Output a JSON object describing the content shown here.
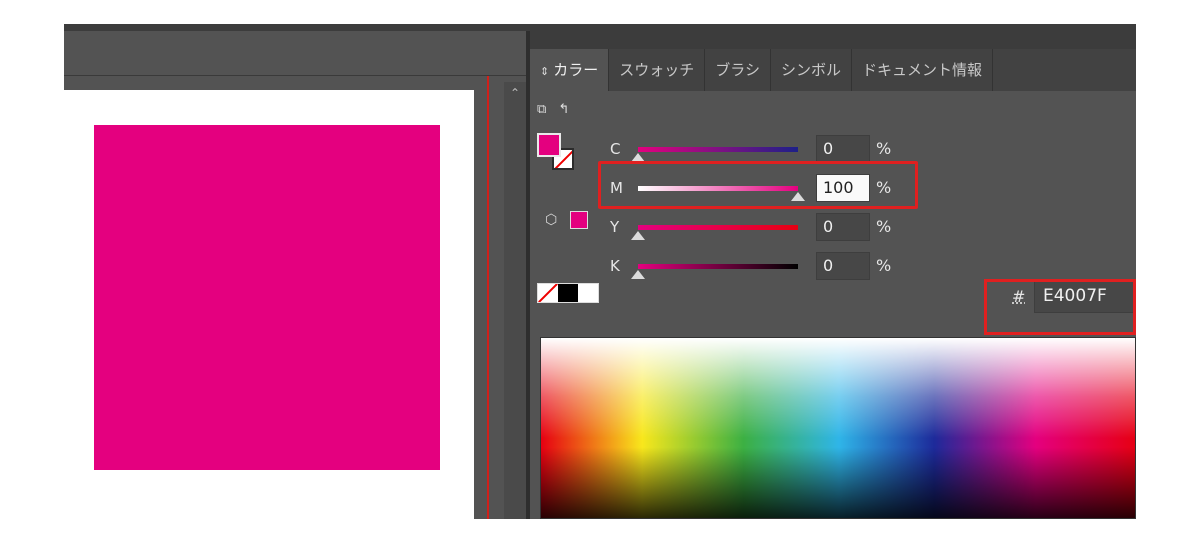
{
  "panel": {
    "tabs": [
      {
        "label": "カラー",
        "active": true
      },
      {
        "label": "スウォッチ",
        "active": false
      },
      {
        "label": "ブラシ",
        "active": false
      },
      {
        "label": "シンボル",
        "active": false
      },
      {
        "label": "ドキュメント情報",
        "active": false
      }
    ],
    "tab_arrows_icon": "⇕"
  },
  "color": {
    "fill_hex": "#E4007F",
    "channels": [
      {
        "label": "C",
        "value": "0",
        "unit": "%",
        "level": 0
      },
      {
        "label": "M",
        "value": "100",
        "unit": "%",
        "level": 1
      },
      {
        "label": "Y",
        "value": "0",
        "unit": "%",
        "level": 0
      },
      {
        "label": "K",
        "value": "0",
        "unit": "%",
        "level": 0
      }
    ],
    "hex_symbol": "#",
    "hex_value": "E4007F"
  },
  "document": {
    "artwork_color": "#E4007F"
  },
  "colors": {
    "highlight": "#e02020",
    "guide": "#d0201a",
    "ui_gray": "#535353"
  },
  "icons": {
    "swap": "swap-fill-stroke-icon",
    "default": "default-fill-stroke-icon",
    "gamut": "out-of-web-gamut-cube-icon",
    "scroll_up": "chevron-up-icon"
  }
}
